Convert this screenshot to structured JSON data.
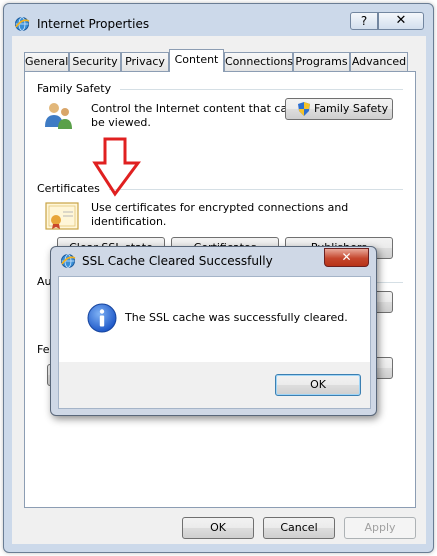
{
  "window": {
    "title": "Internet Properties",
    "help_label": "?",
    "close_label": "✕"
  },
  "tabs": [
    "General",
    "Security",
    "Privacy",
    "Content",
    "Connections",
    "Programs",
    "Advanced"
  ],
  "family_safety": {
    "heading": "Family Safety",
    "line1": "Control the Internet content that can",
    "line2": "be viewed.",
    "button_label": "Family Safety"
  },
  "certificates": {
    "heading": "Certificates",
    "description": "Use certificates for encrypted connections and identification.",
    "clear_ssl_label": "Clear SSL state",
    "certificates_label": "Certificates",
    "publishers_label": "Publishers"
  },
  "autocomplete": {
    "heading": "AutoComplete"
  },
  "feeds": {
    "heading": "Fee"
  },
  "footer": {
    "ok_label": "OK",
    "cancel_label": "Cancel",
    "apply_label": "Apply"
  },
  "dialog": {
    "title": "SSL Cache Cleared Successfully",
    "message": "The SSL cache was successfully cleared.",
    "ok_label": "OK",
    "close_label": "✕"
  },
  "colors": {
    "annotation_arrow": "#e02020",
    "info_icon": "#1e58c8",
    "dialog_close": "#c5462d"
  }
}
